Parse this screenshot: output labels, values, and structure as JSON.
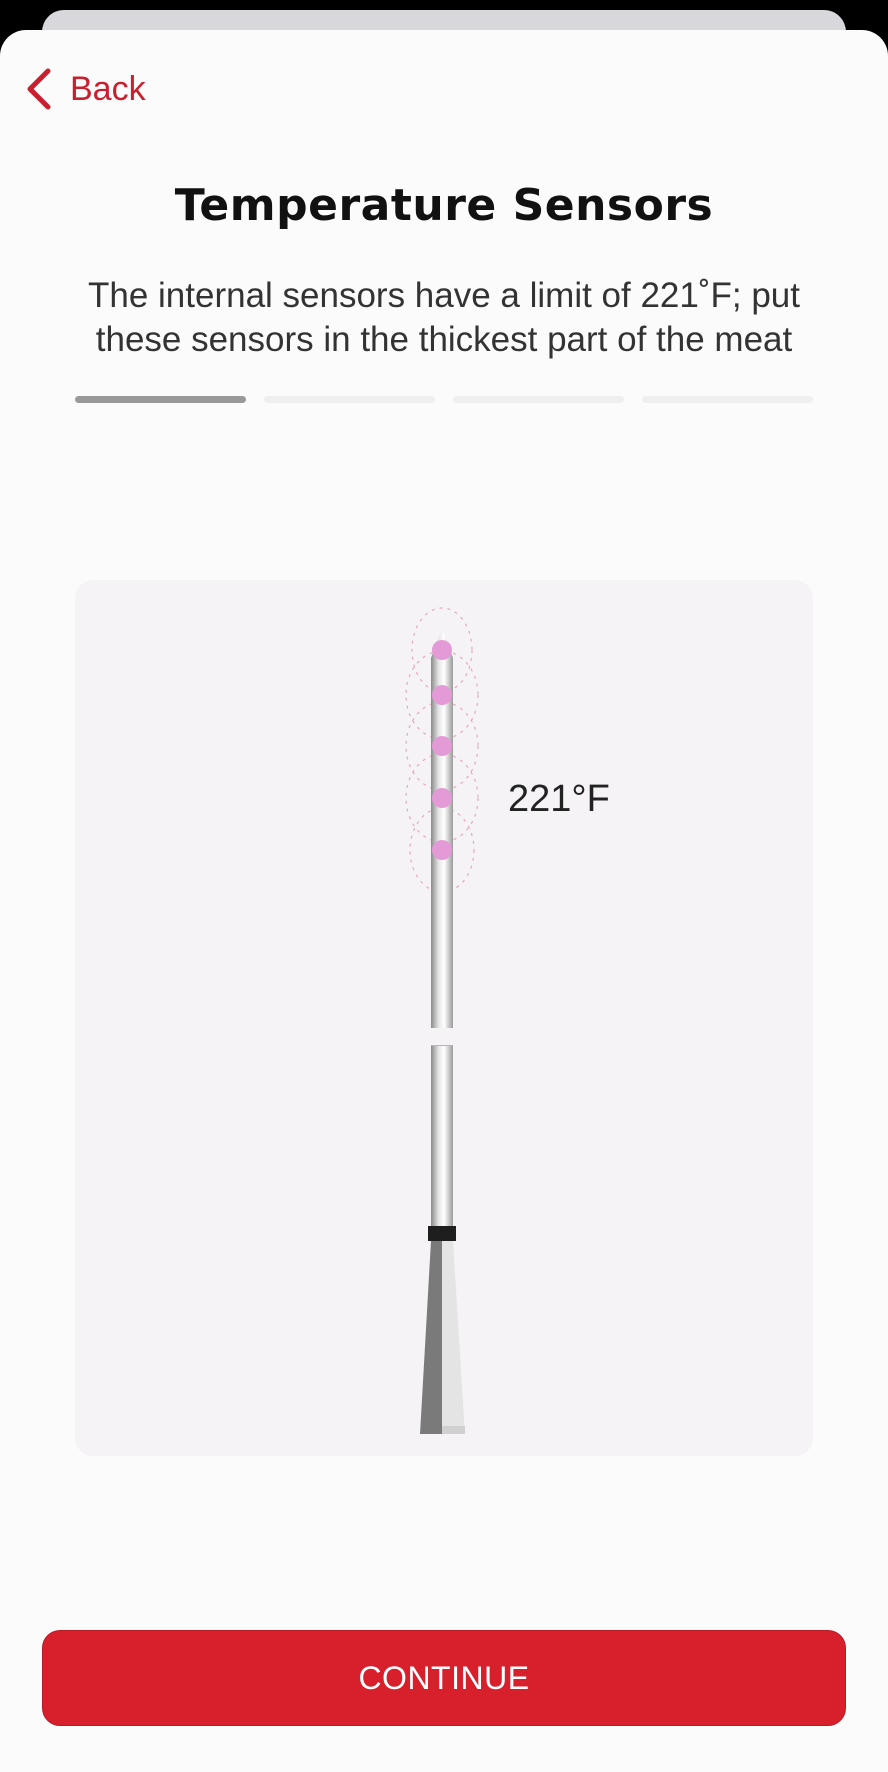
{
  "nav": {
    "back_label": "Back"
  },
  "screen": {
    "title": "Temperature Sensors",
    "subtitle": "The internal sensors have a limit of 221˚F; put these sensors in the thickest part of the meat"
  },
  "progress": {
    "current_step": 1,
    "total_steps": 4
  },
  "illustration": {
    "temperature_label": "221°F",
    "sensor_count": 5,
    "sensor_color": "#e49ad6"
  },
  "footer": {
    "continue_label": "CONTINUE"
  },
  "colors": {
    "accent": "#d8202d",
    "back": "#c8202f"
  }
}
